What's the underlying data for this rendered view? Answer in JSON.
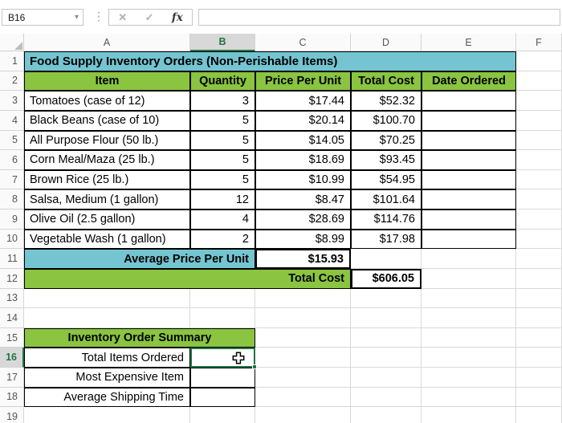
{
  "topbar": {
    "name_box_value": "B16",
    "formula_value": "",
    "icons": {
      "dropdown": "▾",
      "separator": "⋮",
      "cancel": "✕",
      "enter": "✓",
      "function": "fx"
    }
  },
  "colors": {
    "banner_teal": "#74c5d1",
    "banner_green": "#8ac440",
    "selection_green": "#217346"
  },
  "sheet": {
    "column_headers": [
      "A",
      "B",
      "C",
      "D",
      "E",
      "F"
    ],
    "selected_column": "B",
    "row_headers": [
      "1",
      "2",
      "3",
      "4",
      "5",
      "6",
      "7",
      "8",
      "9",
      "10",
      "11",
      "12",
      "13",
      "14",
      "15",
      "16",
      "17",
      "18",
      "19"
    ],
    "selected_row": "16",
    "selected_cell": "B16"
  },
  "inventory_table": {
    "title": "Food Supply Inventory Orders (Non-Perishable Items)",
    "columns": [
      "Item",
      "Quantity",
      "Price Per Unit",
      "Total Cost",
      "Date Ordered"
    ],
    "rows": [
      {
        "item": "Tomatoes (case of 12)",
        "quantity": "3",
        "price_per_unit": "$17.44",
        "total_cost": "$52.32",
        "date_ordered": ""
      },
      {
        "item": "Black Beans (case of 10)",
        "quantity": "5",
        "price_per_unit": "$20.14",
        "total_cost": "$100.70",
        "date_ordered": ""
      },
      {
        "item": "All Purpose Flour (50 lb.)",
        "quantity": "5",
        "price_per_unit": "$14.05",
        "total_cost": "$70.25",
        "date_ordered": ""
      },
      {
        "item": "Corn Meal/Maza (25 lb.)",
        "quantity": "5",
        "price_per_unit": "$18.69",
        "total_cost": "$93.45",
        "date_ordered": ""
      },
      {
        "item": "Brown Rice (25 lb.)",
        "quantity": "5",
        "price_per_unit": "$10.99",
        "total_cost": "$54.95",
        "date_ordered": ""
      },
      {
        "item": "Salsa, Medium (1 gallon)",
        "quantity": "12",
        "price_per_unit": "$8.47",
        "total_cost": "$101.64",
        "date_ordered": ""
      },
      {
        "item": "Olive Oil (2.5 gallon)",
        "quantity": "4",
        "price_per_unit": "$28.69",
        "total_cost": "$114.76",
        "date_ordered": ""
      },
      {
        "item": "Vegetable Wash (1 gallon)",
        "quantity": "2",
        "price_per_unit": "$8.99",
        "total_cost": "$17.98",
        "date_ordered": ""
      }
    ],
    "average_label": "Average Price Per Unit",
    "average_value": "$15.93",
    "total_label": "Total Cost",
    "total_value": "$606.05"
  },
  "summary_table": {
    "title": "Inventory Order Summary",
    "rows": [
      {
        "label": "Total Items Ordered",
        "value": ""
      },
      {
        "label": "Most Expensive Item",
        "value": ""
      },
      {
        "label": "Average Shipping Time",
        "value": ""
      }
    ]
  }
}
